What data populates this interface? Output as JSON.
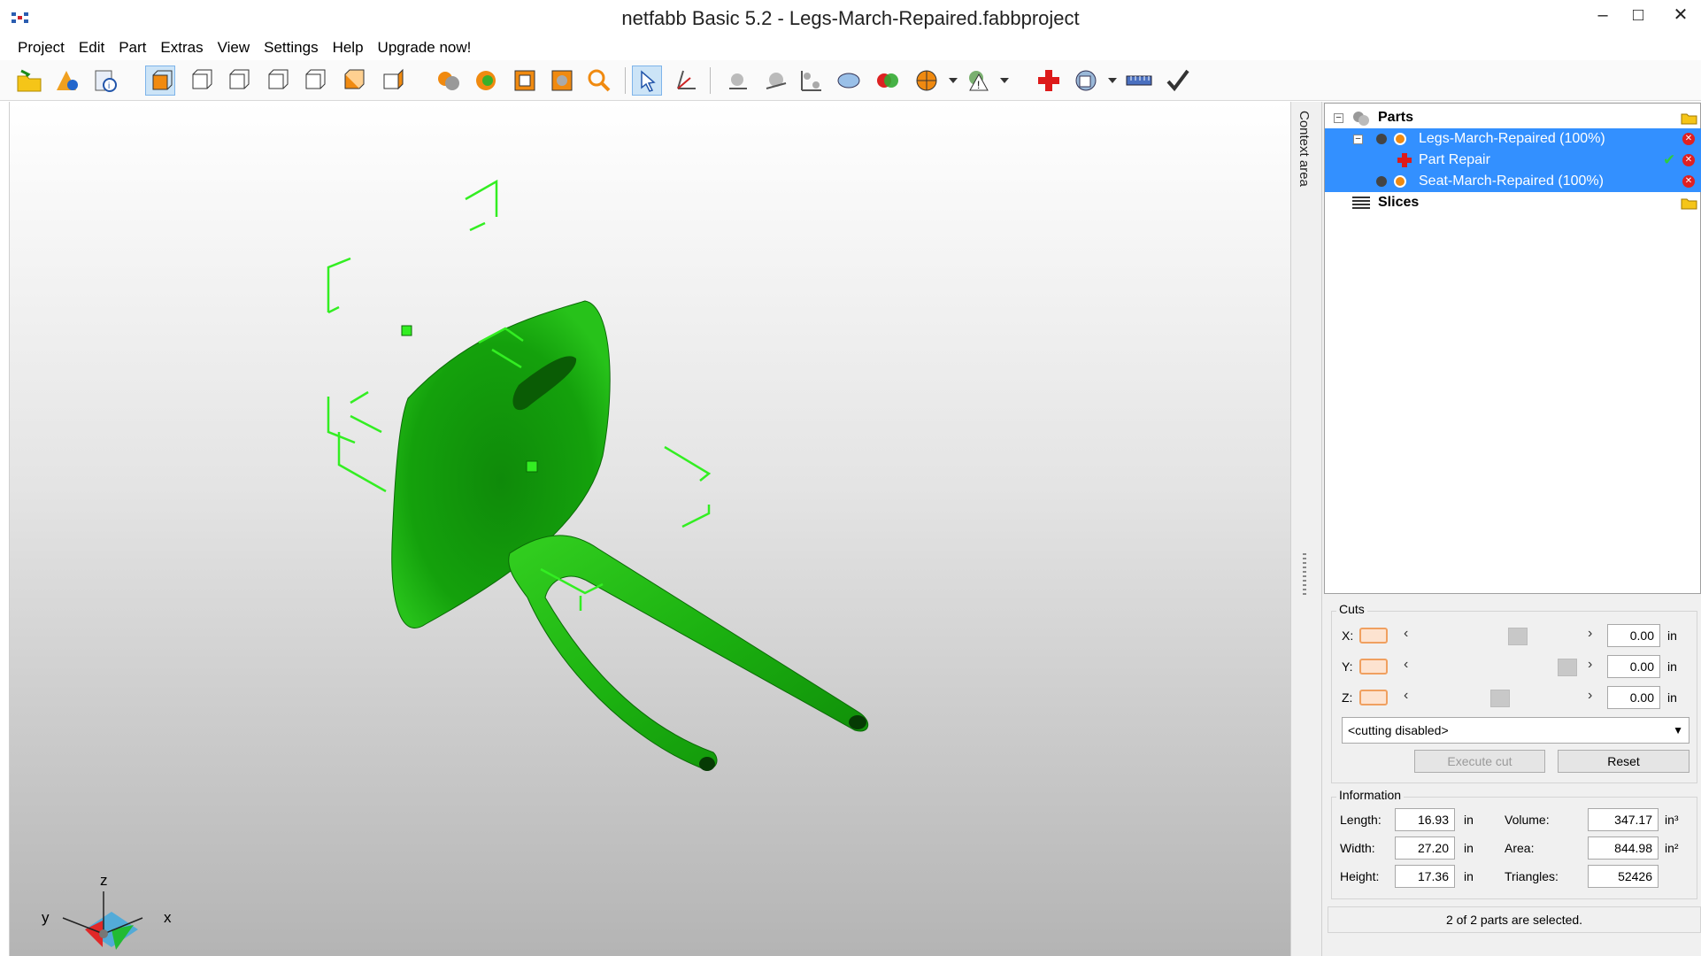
{
  "window": {
    "title": "netfabb Basic 5.2 - Legs-March-Repaired.fabbproject",
    "minimize": "–",
    "maximize": "□",
    "close": "✕"
  },
  "menu": [
    "Project",
    "Edit",
    "Part",
    "Extras",
    "View",
    "Settings",
    "Help",
    "Upgrade now!"
  ],
  "toolbar_icons": [
    "open-project-icon",
    "add-part-icon",
    "part-info-icon",
    "view-3d-icon",
    "view-front-icon",
    "view-back-icon",
    "view-left-icon",
    "view-right-icon",
    "view-top-icon",
    "view-bottom-icon",
    "shading-icon",
    "color-icon",
    "wireframe-icon",
    "box-view-icon",
    "zoom-icon",
    "select-icon",
    "move-icon",
    "point-icon",
    "sphere-icon",
    "axis-icon",
    "plane-icon",
    "boolean-icon",
    "section-icon",
    "warning-icon",
    "repair-icon",
    "analysis-icon",
    "measure-icon",
    "finish-icon"
  ],
  "viewport": {
    "axis_labels": {
      "z": "z",
      "y": "y",
      "x": "x"
    },
    "model_color": "#16a80b",
    "bbox_color": "#33ee22"
  },
  "context_area": {
    "label": "Context area"
  },
  "tree": {
    "root": "Parts",
    "items": [
      {
        "label": "Legs-March-Repaired (100%)",
        "selected": true
      },
      {
        "label": "Part Repair",
        "selected": true
      },
      {
        "label": "Seat-March-Repaired (100%)",
        "selected": true
      }
    ],
    "slices": "Slices",
    "selection_color": "#3390ff"
  },
  "cuts": {
    "title": "Cuts",
    "rows": [
      {
        "axis": "X:",
        "value": "0.00",
        "unit": "in",
        "level": 0.55
      },
      {
        "axis": "Y:",
        "value": "0.00",
        "unit": "in",
        "level": 0.98
      },
      {
        "axis": "Z:",
        "value": "0.00",
        "unit": "in",
        "level": 0.45
      }
    ],
    "dropdown": "<cutting disabled>",
    "execute": "Execute cut",
    "reset": "Reset"
  },
  "information": {
    "title": "Information",
    "length_label": "Length:",
    "length": "16.93",
    "width_label": "Width:",
    "width": "27.20",
    "height_label": "Height:",
    "height": "17.36",
    "unit": "in",
    "volume_label": "Volume:",
    "volume": "347.17",
    "volume_unit": "in³",
    "area_label": "Area:",
    "area": "844.98",
    "area_unit": "in²",
    "triangles_label": "Triangles:",
    "triangles": "52426"
  },
  "status": "2 of 2 parts are selected."
}
